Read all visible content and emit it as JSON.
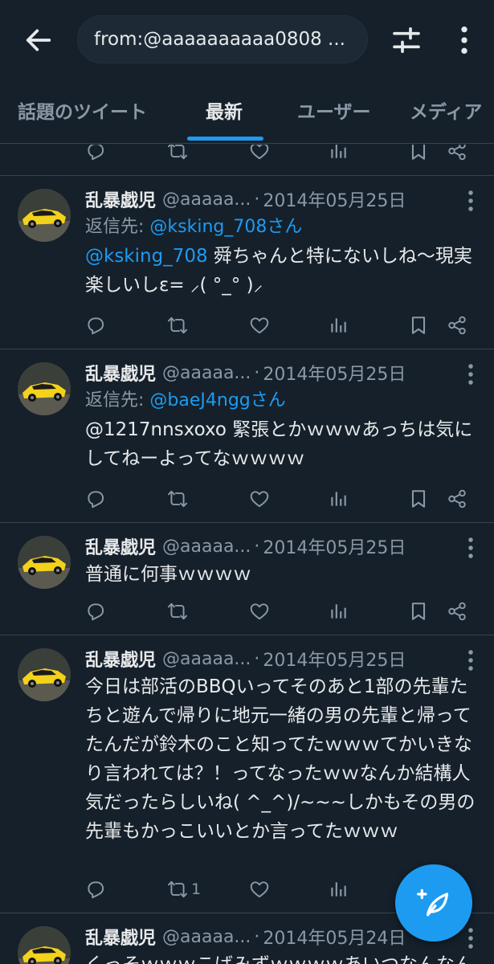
{
  "search": {
    "query": "from:@aaaaaaaaaa0808 ..."
  },
  "tabs": [
    {
      "label": "話題のツイート"
    },
    {
      "label": "最新"
    },
    {
      "label": "ユーザー"
    },
    {
      "label": "メディア"
    }
  ],
  "active_tab": "最新",
  "tweets": [
    {
      "display_name": "乱暴戯児",
      "handle": "@aaaaa...",
      "date": "2014年05月25日",
      "reply_prefix": "返信先: ",
      "reply_to": "@ksking_708さん",
      "mention": "@ksking_708",
      "text": " 舜ちゃんと特にないしね〜現実楽しいしε= ⸝( °_° )⸝",
      "retweets": ""
    },
    {
      "display_name": "乱暴戯児",
      "handle": "@aaaaa...",
      "date": "2014年05月25日",
      "reply_prefix": "返信先: ",
      "reply_to": "@baeJ4nggさん",
      "text": "@1217nnsxoxo 緊張とかｗｗｗあっちは気にしてねーよってなｗｗｗｗ",
      "retweets": ""
    },
    {
      "display_name": "乱暴戯児",
      "handle": "@aaaaa...",
      "date": "2014年05月25日",
      "text": "普通に何事ｗｗｗｗ",
      "retweets": ""
    },
    {
      "display_name": "乱暴戯児",
      "handle": "@aaaaa...",
      "date": "2014年05月25日",
      "text": "今日は部活のBBQいってそのあと1部の先輩たちと遊んで帰りに地元一緒の男の先輩と帰ってたんだが鈴木のこと知ってたｗｗｗてかいきなり言われては？！ってなったｗｗなんか結構人気だったらしいね( ^_^)/~~~しかもその男の先輩もかっこいいとか言ってたｗｗｗ",
      "retweets": "1"
    },
    {
      "display_name": "乱暴戯児",
      "handle": "@aaaaa...",
      "date": "2014年05月24日",
      "text": "くっそｗｗｗこばみずｗｗｗｗあいつなんなん",
      "retweets": ""
    }
  ],
  "colors": {
    "background": "#15202b",
    "accent": "#1d9bf0",
    "muted": "#8b98a5",
    "divider": "#38444d"
  },
  "icons": [
    "back-arrow-icon",
    "filter-sliders-icon",
    "more-vertical-icon",
    "reply-icon",
    "retweet-icon",
    "like-icon",
    "views-icon",
    "bookmark-icon",
    "share-icon",
    "compose-tweet-icon"
  ]
}
